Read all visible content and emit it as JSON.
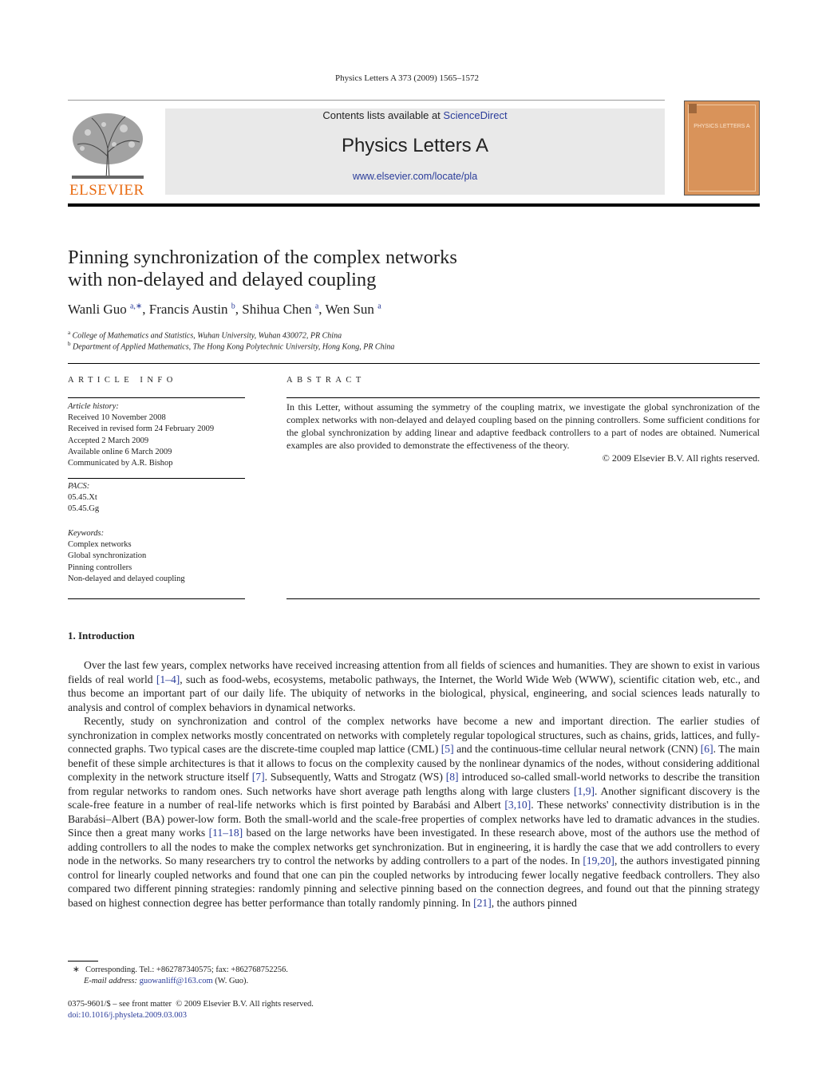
{
  "header": {
    "journal_ref": "Physics Letters A 373 (2009) 1565–1572",
    "contents_prefix": "Contents lists available at ",
    "contents_link": "ScienceDirect",
    "journal_name": "Physics Letters A",
    "journal_url": "www.elsevier.com/locate/pla",
    "publisher_logo": "ELSEVIER",
    "cover_title": "PHYSICS LETTERS A",
    "accent_color": "#e86a10",
    "link_color": "#2a3c9a"
  },
  "article": {
    "title_line1": "Pinning synchronization of the complex networks",
    "title_line2": "with non-delayed and delayed coupling",
    "authors": [
      {
        "name": "Wanli Guo",
        "sup": "a,∗"
      },
      {
        "name": "Francis Austin",
        "sup": "b"
      },
      {
        "name": "Shihua Chen",
        "sup": "a"
      },
      {
        "name": "Wen Sun",
        "sup": "a"
      }
    ],
    "affiliations": [
      {
        "mark": "a",
        "text": "College of Mathematics and Statistics, Wuhan University, Wuhan 430072, PR China"
      },
      {
        "mark": "b",
        "text": "Department of Applied Mathematics, The Hong Kong Polytechnic University, Hong Kong, PR China"
      }
    ]
  },
  "article_info": {
    "heading": "ARTICLE INFO",
    "history_label": "Article history:",
    "history": [
      "Received 10 November 2008",
      "Received in revised form 24 February 2009",
      "Accepted 2 March 2009",
      "Available online 6 March 2009",
      "Communicated by A.R. Bishop"
    ],
    "pacs_label": "PACS:",
    "pacs": [
      "05.45.Xt",
      "05.45.Gg"
    ],
    "keywords_label": "Keywords:",
    "keywords": [
      "Complex networks",
      "Global synchronization",
      "Pinning controllers",
      "Non-delayed and delayed coupling"
    ]
  },
  "abstract": {
    "heading": "ABSTRACT",
    "text": "In this Letter, without assuming the symmetry of the coupling matrix, we investigate the global synchronization of the complex networks with non-delayed and delayed coupling based on the pinning controllers. Some sufficient conditions for the global synchronization by adding linear and adaptive feedback controllers to a part of nodes are obtained. Numerical examples are also provided to demonstrate the effectiveness of the theory.",
    "copyright": "© 2009 Elsevier B.V. All rights reserved."
  },
  "section1": {
    "heading": "1. Introduction",
    "p1": [
      "Over the last few years, complex networks have received increasing attention from all fields of sciences and humanities. They are shown to exist in various fields of real world ",
      "[1–4]",
      ", such as food-webs, ecosystems, metabolic pathways, the Internet, the World Wide Web (WWW), scientific citation web, etc., and thus become an important part of our daily life. The ubiquity of networks in the biological, physical, engineering, and social sciences leads naturally to analysis and control of complex behaviors in dynamical networks."
    ],
    "p2": [
      "Recently, study on synchronization and control of the complex networks have become a new and important direction. The earlier studies of synchronization in complex networks mostly concentrated on networks with completely regular topological structures, such as chains, grids, lattices, and fully-connected graphs. Two typical cases are the discrete-time coupled map lattice (CML) ",
      "[5]",
      " and the continuous-time cellular neural network (CNN) ",
      "[6]",
      ". The main benefit of these simple architectures is that it allows to focus on the complexity caused by the nonlinear dynamics of the nodes, without considering additional complexity in the network structure itself ",
      "[7]",
      ". Subsequently, Watts and Strogatz (WS) ",
      "[8]",
      " introduced so-called small-world networks to describe the transition from regular networks to random ones. Such networks have short average path lengths along with large clusters ",
      "[1,9]",
      ". Another significant discovery is the scale-free feature in a number of real-life networks which is first pointed by Barabási and Albert ",
      "[3,10]",
      ". These networks' connectivity distribution is in the Barabási–Albert (BA) power-low form. Both the small-world and the scale-free properties of complex networks have led to dramatic advances in the studies. Since then a great many works ",
      "[11–18]",
      " based on the large networks have been investigated. In these research above, most of the authors use the method of adding controllers to all the nodes to make the complex networks get synchronization. But in engineering, it is hardly the case that we add controllers to every node in the networks. So many researchers try to control the networks by adding controllers to a part of the nodes. In ",
      "[19,20]",
      ", the authors investigated pinning control for linearly coupled networks and found that one can pin the coupled networks by introducing fewer locally negative feedback controllers. They also compared two different pinning strategies: randomly pinning and selective pinning based on the connection degrees, and found out that the pinning strategy based on highest connection degree has better performance than totally randomly pinning. In ",
      "[21]",
      ", the authors pinned"
    ]
  },
  "footnotes": {
    "mark": "∗",
    "corresponding": "Corresponding. Tel.: +862787340575; fax: +862768752256.",
    "email_label": "E-mail address:",
    "email": "guowanliff@163.com",
    "email_suffix": " (W. Guo).",
    "issn": "0375-9601/$ – see front matter  © 2009 Elsevier B.V. All rights reserved.",
    "doi": "doi:10.1016/j.physleta.2009.03.003"
  }
}
